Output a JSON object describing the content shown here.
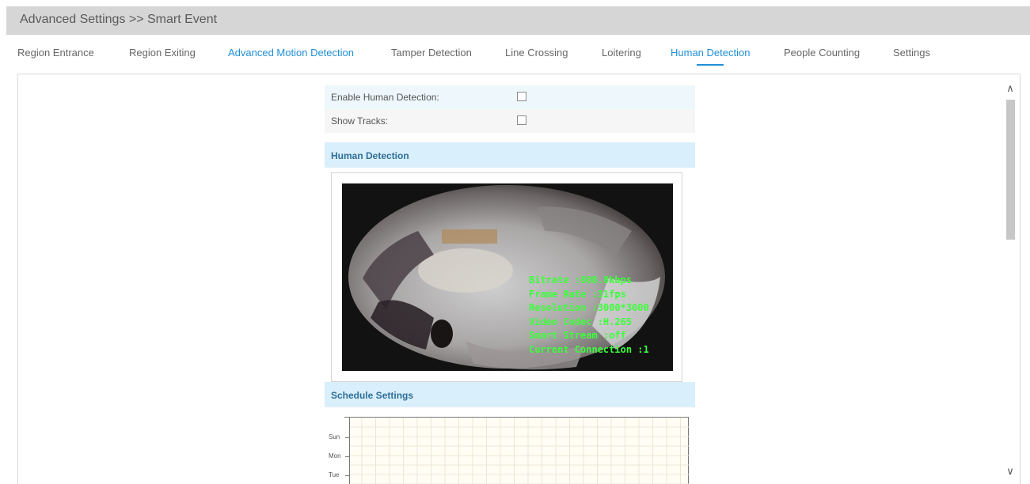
{
  "header": {
    "title": "Advanced Settings >> Smart Event"
  },
  "tabs": [
    {
      "label": "Region Entrance"
    },
    {
      "label": "Region Exiting"
    },
    {
      "label": "Advanced Motion Detection"
    },
    {
      "label": "Tamper Detection"
    },
    {
      "label": "Line Crossing"
    },
    {
      "label": "Loitering"
    },
    {
      "label": "Human Detection"
    },
    {
      "label": "People Counting"
    },
    {
      "label": "Settings"
    }
  ],
  "active_tab": "Human Detection",
  "options": {
    "enable_label": "Enable Human Detection:",
    "enable_checked": false,
    "tracks_label": "Show Tracks:",
    "tracks_checked": false
  },
  "sections": {
    "human_detection": "Human Detection",
    "schedule": "Schedule Settings"
  },
  "video": {
    "osd": [
      "Bitrate :808.8kbps",
      "Frame Rate :31fps",
      "Resolution :3000*3000",
      "Video Codec :H.265",
      "Smart Stream :off",
      "Current Connection :1"
    ]
  },
  "schedule": {
    "days": [
      "Sun",
      "Mon",
      "Tue"
    ]
  },
  "colors": {
    "accent": "#1f8fd6",
    "section_bg": "#d9effb",
    "osd_text": "#3cff3c"
  },
  "icons": {
    "scroll_up": "chevron-up-icon",
    "scroll_down": "chevron-down-icon"
  }
}
